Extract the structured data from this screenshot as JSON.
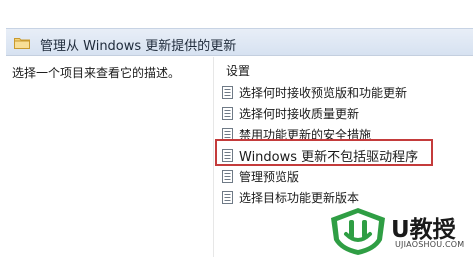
{
  "header": {
    "title": "管理从 Windows 更新提供的更新",
    "icon": "folder-icon"
  },
  "left_pane": {
    "description": "选择一个项目来查看它的描述。"
  },
  "settings": {
    "column_header": "设置",
    "items": [
      {
        "label": "选择何时接收预览版和功能更新",
        "icon": "policy-setting-icon"
      },
      {
        "label": "选择何时接收质量更新",
        "icon": "policy-setting-icon"
      },
      {
        "label": "禁用功能更新的安全措施",
        "icon": "policy-setting-icon"
      },
      {
        "label": "Windows 更新不包括驱动程序",
        "icon": "policy-setting-icon",
        "highlighted": true
      },
      {
        "label": "管理预览版",
        "icon": "policy-setting-icon"
      },
      {
        "label": "选择目标功能更新版本",
        "icon": "policy-setting-icon"
      }
    ],
    "highlight_color": "#c43b3b"
  },
  "watermark": {
    "brand": "U教授",
    "url": "UJIAOSHOU.COM",
    "icon": "shield-logo-icon",
    "accent": "#2f9e44"
  }
}
